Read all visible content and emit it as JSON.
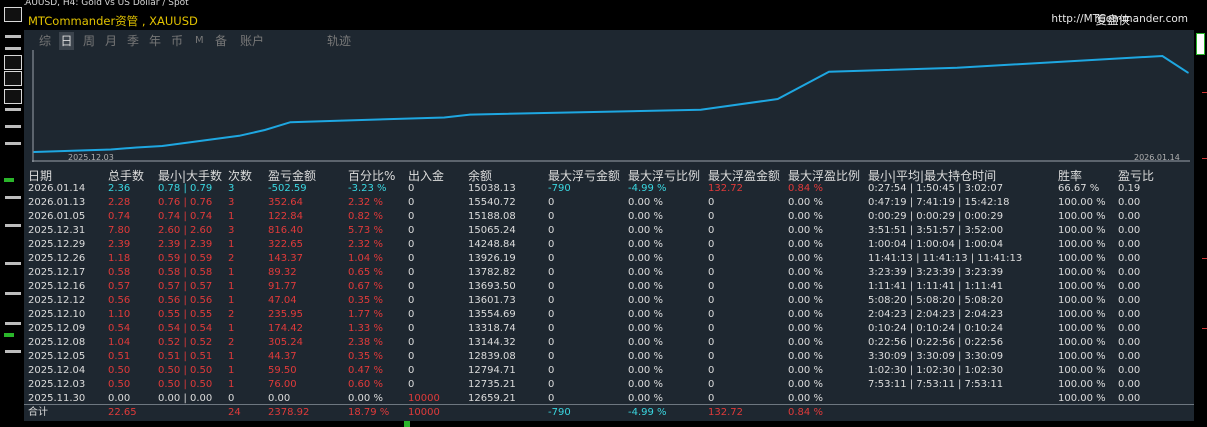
{
  "window": {
    "symbol_title": "XAUUSD, H4:  Gold vs US Dollar / Spot"
  },
  "panel": {
    "title": "MTCommander资管 , XAUUSD",
    "brand": "复盘侠",
    "url": "http://MTCommander.com",
    "tabs": [
      "综",
      "日",
      "周",
      "月",
      "季",
      "年",
      "币",
      "M",
      "备",
      "账户",
      "轨迹"
    ],
    "active_tab": "日"
  },
  "chart_data": {
    "type": "line",
    "x_start_label": "2025.12.03",
    "x_end_label": "2026.01.14",
    "x": [
      "2025.11.30",
      "2025.12.03",
      "2025.12.04",
      "2025.12.05",
      "2025.12.08",
      "2025.12.09",
      "2025.12.10",
      "2025.12.12",
      "2025.12.16",
      "2025.12.17",
      "2025.12.26",
      "2025.12.29",
      "2025.12.31",
      "2026.01.05",
      "2026.01.13",
      "2026.01.14"
    ],
    "values": [
      12659.21,
      12735.21,
      12794.71,
      12839.08,
      13144.32,
      13318.74,
      13554.69,
      13601.73,
      13693.5,
      13782.82,
      13926.19,
      14248.84,
      15065.24,
      15188.08,
      15540.72,
      15038.13
    ],
    "line_color": "#1ea7e1"
  },
  "table": {
    "headers": [
      "日期",
      "总手数",
      "最小|大手数",
      "次数",
      "盈亏金额",
      "百分比%",
      "出入金",
      "余额",
      "最大浮亏金额",
      "最大浮亏比例",
      "最大浮盈金额",
      "最大浮盈比例",
      "最小|平均|最大持仓时间",
      "胜率",
      "盈亏比"
    ],
    "rows": [
      [
        "2026.01.14",
        "2.36",
        "0.78 | 0.79",
        "3",
        "-502.59",
        "-3.23 %",
        "0",
        "15038.13",
        "-790",
        "-4.99 %",
        "132.72",
        "0.84 %",
        "0:27:54 | 1:50:45 | 3:02:07",
        "66.67 %",
        "0.19"
      ],
      [
        "2026.01.13",
        "2.28",
        "0.76 | 0.76",
        "3",
        "352.64",
        "2.32 %",
        "0",
        "15540.72",
        "0",
        "0.00 %",
        "0",
        "0.00 %",
        "0:47:19 | 7:41:19 | 15:42:18",
        "100.00 %",
        "0.00"
      ],
      [
        "2026.01.05",
        "0.74",
        "0.74 | 0.74",
        "1",
        "122.84",
        "0.82 %",
        "0",
        "15188.08",
        "0",
        "0.00 %",
        "0",
        "0.00 %",
        "0:00:29 | 0:00:29 | 0:00:29",
        "100.00 %",
        "0.00"
      ],
      [
        "2025.12.31",
        "7.80",
        "2.60 | 2.60",
        "3",
        "816.40",
        "5.73 %",
        "0",
        "15065.24",
        "0",
        "0.00 %",
        "0",
        "0.00 %",
        "3:51:51 | 3:51:57 | 3:52:00",
        "100.00 %",
        "0.00"
      ],
      [
        "2025.12.29",
        "2.39",
        "2.39 | 2.39",
        "1",
        "322.65",
        "2.32 %",
        "0",
        "14248.84",
        "0",
        "0.00 %",
        "0",
        "0.00 %",
        "1:00:04 | 1:00:04 | 1:00:04",
        "100.00 %",
        "0.00"
      ],
      [
        "2025.12.26",
        "1.18",
        "0.59 | 0.59",
        "2",
        "143.37",
        "1.04 %",
        "0",
        "13926.19",
        "0",
        "0.00 %",
        "0",
        "0.00 %",
        "11:41:13 | 11:41:13 | 11:41:13",
        "100.00 %",
        "0.00"
      ],
      [
        "2025.12.17",
        "0.58",
        "0.58 | 0.58",
        "1",
        "89.32",
        "0.65 %",
        "0",
        "13782.82",
        "0",
        "0.00 %",
        "0",
        "0.00 %",
        "3:23:39 | 3:23:39 | 3:23:39",
        "100.00 %",
        "0.00"
      ],
      [
        "2025.12.16",
        "0.57",
        "0.57 | 0.57",
        "1",
        "91.77",
        "0.67 %",
        "0",
        "13693.50",
        "0",
        "0.00 %",
        "0",
        "0.00 %",
        "1:11:41 | 1:11:41 | 1:11:41",
        "100.00 %",
        "0.00"
      ],
      [
        "2025.12.12",
        "0.56",
        "0.56 | 0.56",
        "1",
        "47.04",
        "0.35 %",
        "0",
        "13601.73",
        "0",
        "0.00 %",
        "0",
        "0.00 %",
        "5:08:20 | 5:08:20 | 5:08:20",
        "100.00 %",
        "0.00"
      ],
      [
        "2025.12.10",
        "1.10",
        "0.55 | 0.55",
        "2",
        "235.95",
        "1.77 %",
        "0",
        "13554.69",
        "0",
        "0.00 %",
        "0",
        "0.00 %",
        "2:04:23 | 2:04:23 | 2:04:23",
        "100.00 %",
        "0.00"
      ],
      [
        "2025.12.09",
        "0.54",
        "0.54 | 0.54",
        "1",
        "174.42",
        "1.33 %",
        "0",
        "13318.74",
        "0",
        "0.00 %",
        "0",
        "0.00 %",
        "0:10:24 | 0:10:24 | 0:10:24",
        "100.00 %",
        "0.00"
      ],
      [
        "2025.12.08",
        "1.04",
        "0.52 | 0.52",
        "2",
        "305.24",
        "2.38 %",
        "0",
        "13144.32",
        "0",
        "0.00 %",
        "0",
        "0.00 %",
        "0:22:56 | 0:22:56 | 0:22:56",
        "100.00 %",
        "0.00"
      ],
      [
        "2025.12.05",
        "0.51",
        "0.51 | 0.51",
        "1",
        "44.37",
        "0.35 %",
        "0",
        "12839.08",
        "0",
        "0.00 %",
        "0",
        "0.00 %",
        "3:30:09 | 3:30:09 | 3:30:09",
        "100.00 %",
        "0.00"
      ],
      [
        "2025.12.04",
        "0.50",
        "0.50 | 0.50",
        "1",
        "59.50",
        "0.47 %",
        "0",
        "12794.71",
        "0",
        "0.00 %",
        "0",
        "0.00 %",
        "1:02:30 | 1:02:30 | 1:02:30",
        "100.00 %",
        "0.00"
      ],
      [
        "2025.12.03",
        "0.50",
        "0.50 | 0.50",
        "1",
        "76.00",
        "0.60 %",
        "0",
        "12735.21",
        "0",
        "0.00 %",
        "0",
        "0.00 %",
        "7:53:11 | 7:53:11 | 7:53:11",
        "100.00 %",
        "0.00"
      ],
      [
        "2025.11.30",
        "0.00",
        "0.00 | 0.00",
        "0",
        "0.00",
        "0.00 %",
        "10000",
        "12659.21",
        "0",
        "0.00 %",
        "0",
        "0.00 %",
        "",
        "100.00 %",
        "0.00"
      ]
    ],
    "totals": [
      "合计",
      "22.65",
      "",
      "24",
      "2378.92",
      "18.79 %",
      "10000",
      "",
      "-790",
      "-4.99 %",
      "132.72",
      "0.84 %",
      "",
      "",
      ""
    ]
  },
  "colors": {
    "accent": "#e3c300",
    "negative": "#e03a3a",
    "positive": "#3ad6e0",
    "panel_bg": "#1e2730"
  }
}
